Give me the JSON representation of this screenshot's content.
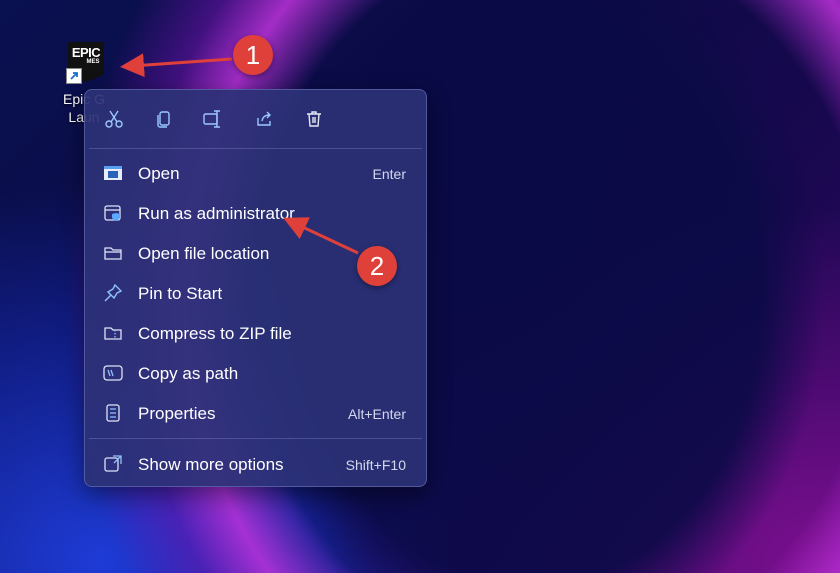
{
  "desktop_icon": {
    "logo_line1": "EPIC",
    "logo_line2": "MES",
    "label_line1": "Epic G",
    "label_line2": "Laun"
  },
  "toolbar": {
    "icons": [
      "cut-icon",
      "copy-icon",
      "rename-icon",
      "share-icon",
      "delete-icon"
    ]
  },
  "menu": {
    "items": [
      {
        "label": "Open",
        "shortcut": "Enter",
        "icon": "open-app-icon"
      },
      {
        "label": "Run as administrator",
        "shortcut": "",
        "icon": "shield-window-icon"
      },
      {
        "label": "Open file location",
        "shortcut": "",
        "icon": "folder-icon"
      },
      {
        "label": "Pin to Start",
        "shortcut": "",
        "icon": "pin-icon"
      },
      {
        "label": "Compress to ZIP file",
        "shortcut": "",
        "icon": "zip-folder-icon"
      },
      {
        "label": "Copy as path",
        "shortcut": "",
        "icon": "path-icon"
      },
      {
        "label": "Properties",
        "shortcut": "Alt+Enter",
        "icon": "properties-icon"
      }
    ],
    "more": {
      "label": "Show more options",
      "shortcut": "Shift+F10",
      "icon": "expand-icon"
    }
  },
  "annotations": {
    "badge1": "1",
    "badge2": "2",
    "color": "#e0403a"
  },
  "colors": {
    "menu_bg": "#2c3276",
    "icon_accent": "#8fc3ff"
  }
}
